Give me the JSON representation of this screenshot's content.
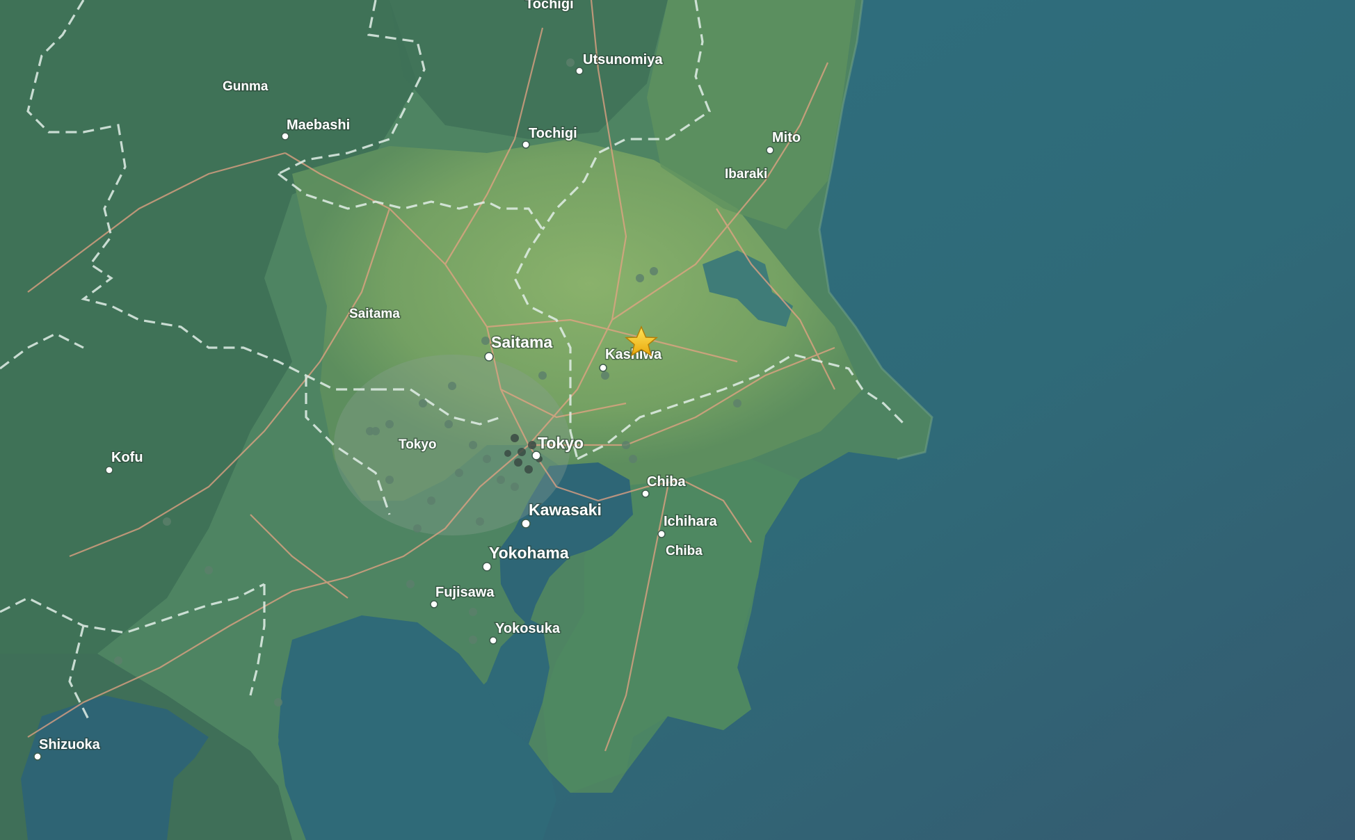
{
  "map": {
    "colors": {
      "ocean": "#2f6a78",
      "ocean_deep": "#335a6e",
      "land": "#4f8462",
      "plain": "#7fa868",
      "mountain": "#3d6e55",
      "road": "#e8a080",
      "border": "#dfeee6",
      "marker": "#f4c51c"
    },
    "cities": {
      "tochigi_top": "Tochigi",
      "utsunomiya": "Utsunomiya",
      "gunma": "Gunma",
      "maebashi": "Maebashi",
      "tochigi": "Tochigi",
      "mito": "Mito",
      "ibaraki": "Ibaraki",
      "saitama_pref": "Saitama",
      "saitama": "Saitama",
      "kashiwa": "Kashiwa",
      "tokyo_pref": "Tokyo",
      "tokyo": "Tokyo",
      "kofu": "Kofu",
      "chiba": "Chiba",
      "kawasaki": "Kawasaki",
      "ichihara": "Ichihara",
      "chiba_pref": "Chiba",
      "yokohama": "Yokohama",
      "fujisawa": "Fujisawa",
      "yokosuka": "Yokosuka",
      "shizuoka": "Shizuoka"
    },
    "marker": {
      "icon": "star-icon",
      "label": "Kashiwa"
    }
  }
}
